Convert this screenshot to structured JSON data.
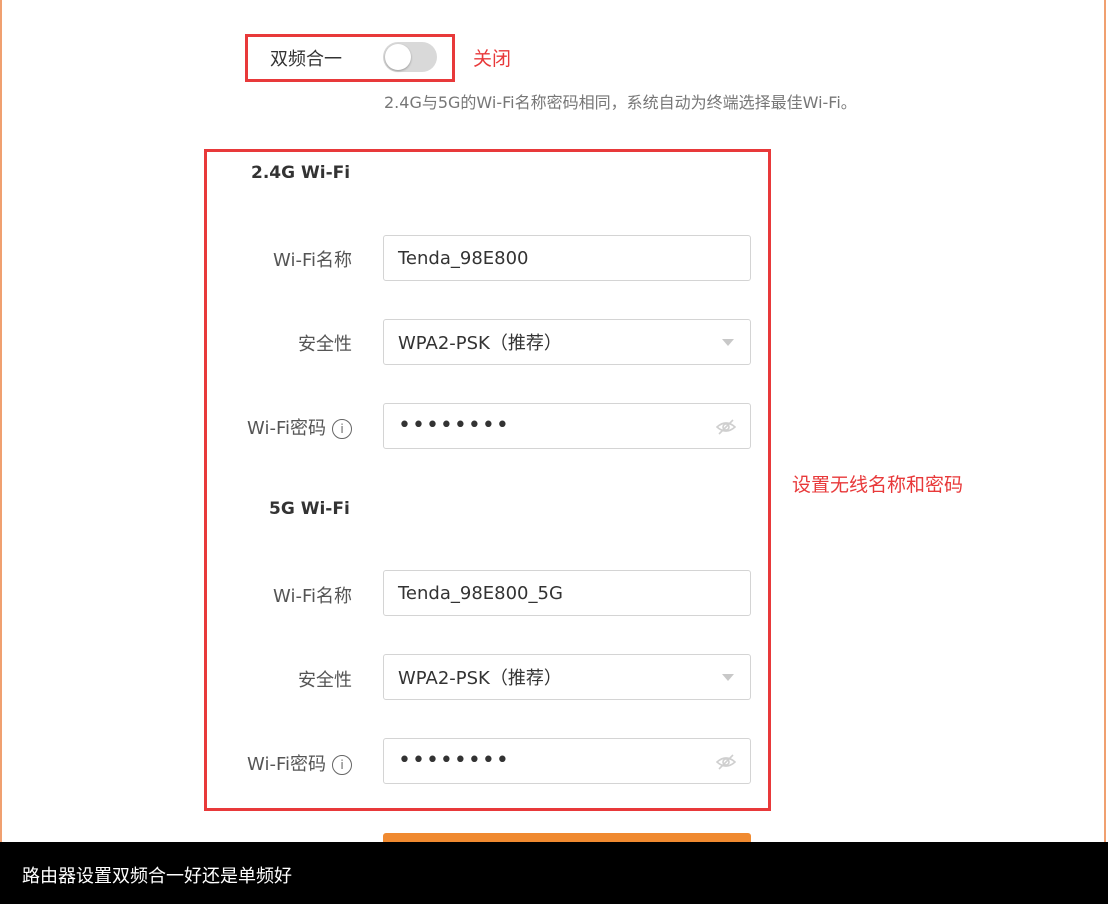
{
  "dual_band": {
    "label": "双频合一",
    "state": "off",
    "state_note": "关闭",
    "hint": "2.4G与5G的Wi-Fi名称密码相同，系统自动为终端选择最佳Wi-Fi。"
  },
  "band_24": {
    "title": "2.4G Wi-Fi",
    "name_label": "Wi-Fi名称",
    "name_value": "Tenda_98E800",
    "security_label": "安全性",
    "security_value": "WPA2-PSK（推荐）",
    "password_label": "Wi-Fi密码",
    "password_value": "••••••••"
  },
  "band_5": {
    "title": "5G Wi-Fi",
    "name_label": "Wi-Fi名称",
    "name_value": "Tenda_98E800_5G",
    "security_label": "安全性",
    "security_value": "WPA2-PSK（推荐）",
    "password_label": "Wi-Fi密码",
    "password_value": "••••••••"
  },
  "side_annotation": "设置无线名称和密码",
  "caption": "路由器设置双频合一好还是单频好",
  "icons": {
    "info": "info-circle-icon",
    "eye": "eye-hidden-icon",
    "dropdown": "chevron-down-icon"
  },
  "colors": {
    "annotation_red": "#e8393a",
    "accent_orange": "#f08a30",
    "toggle_off": "#d9d9d9"
  }
}
